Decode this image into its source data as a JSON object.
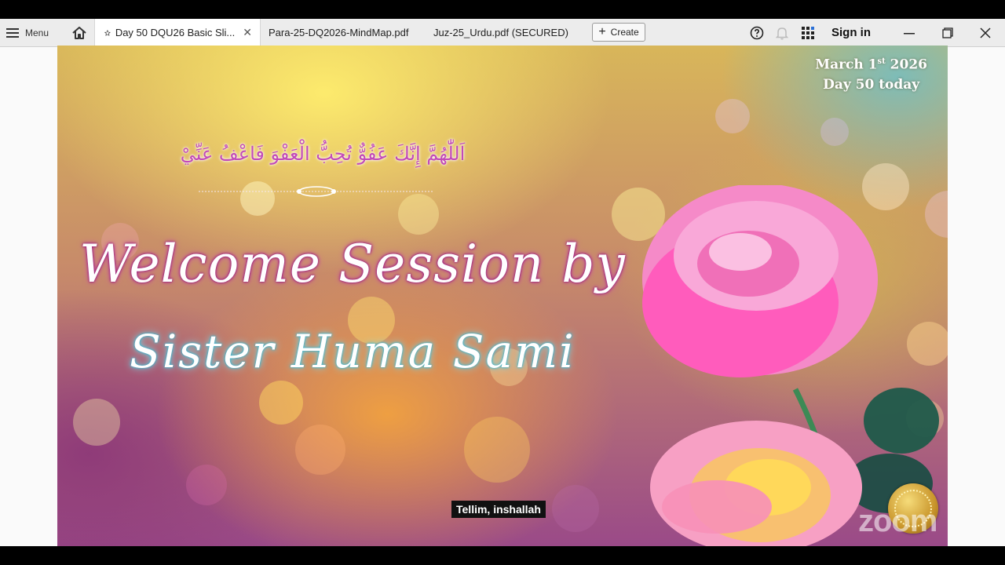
{
  "toolbar": {
    "menu_label": "Menu",
    "tabs": [
      {
        "label": "Day 50 DQU26 Basic Sli...",
        "active": true
      },
      {
        "label": "Para-25-DQ2026-MindMap.pdf",
        "active": false
      },
      {
        "label": "Juz-25_Urdu.pdf (SECURED)",
        "active": false
      }
    ],
    "create_label": "Create",
    "sign_in_label": "Sign in"
  },
  "slide": {
    "date_line1_prefix": "March 1",
    "date_line1_sup": "st",
    "date_line1_suffix": " 2026",
    "date_line2": "Day 50  today",
    "arabic_dua": "اَللّٰهُمَّ إِنَّكَ عَفُوٌّ تُحِبُّ الْعَفْوَ فَاعْفُ عَنِّيْ",
    "title": "Welcome Session by",
    "presenter": "Sister Huma Sami"
  },
  "caption": "Tellim, inshallah",
  "watermark": "zoom",
  "colors": {
    "tabbar_bg": "#ececec",
    "title_glow": "#9a1e78",
    "presenter_glow": "#3fb6cf",
    "arabic_text": "#c24ab8"
  },
  "icons": [
    "hamburger-menu-icon",
    "home-icon",
    "star-icon",
    "close-icon",
    "plus-icon",
    "help-icon",
    "bell-icon",
    "apps-grid-icon",
    "minimize-icon",
    "restore-icon",
    "window-close-icon"
  ]
}
